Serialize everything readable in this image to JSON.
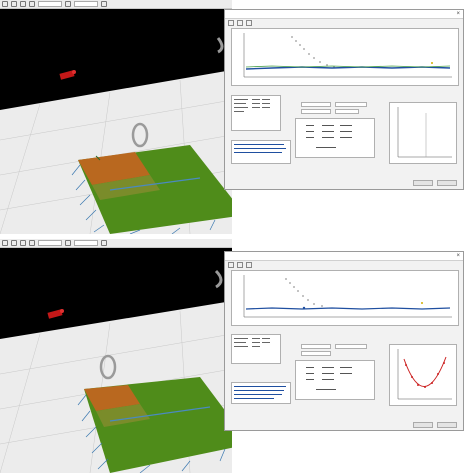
{
  "icons": [
    "file-icon",
    "open-icon",
    "save-icon",
    "cursor-icon",
    "mesh-icon",
    "settings-icon"
  ],
  "colors": {
    "scene_background": "#000000",
    "floor": "#ececec",
    "point_cloud_green": "#5a9a1e",
    "point_cloud_orange": "#c06a18",
    "point_cloud_blue": "#3a78b0",
    "plot_series_blue": "#1f4fa0",
    "plot_series_green": "#4aa04a",
    "fit_curve_red": "#cc2222"
  },
  "screens": [
    {
      "id": "top"
    },
    {
      "id": "bottom"
    }
  ]
}
